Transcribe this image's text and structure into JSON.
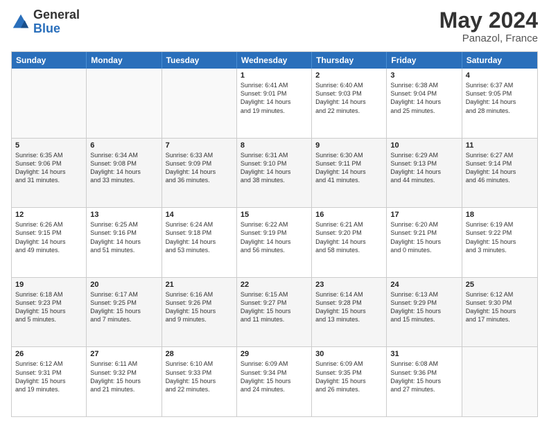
{
  "logo": {
    "general": "General",
    "blue": "Blue"
  },
  "header": {
    "month": "May 2024",
    "location": "Panazol, France"
  },
  "weekdays": [
    "Sunday",
    "Monday",
    "Tuesday",
    "Wednesday",
    "Thursday",
    "Friday",
    "Saturday"
  ],
  "rows": [
    [
      {
        "day": "",
        "info": "",
        "empty": true
      },
      {
        "day": "",
        "info": "",
        "empty": true
      },
      {
        "day": "",
        "info": "",
        "empty": true
      },
      {
        "day": "1",
        "info": "Sunrise: 6:41 AM\nSunset: 9:01 PM\nDaylight: 14 hours\nand 19 minutes."
      },
      {
        "day": "2",
        "info": "Sunrise: 6:40 AM\nSunset: 9:03 PM\nDaylight: 14 hours\nand 22 minutes."
      },
      {
        "day": "3",
        "info": "Sunrise: 6:38 AM\nSunset: 9:04 PM\nDaylight: 14 hours\nand 25 minutes."
      },
      {
        "day": "4",
        "info": "Sunrise: 6:37 AM\nSunset: 9:05 PM\nDaylight: 14 hours\nand 28 minutes."
      }
    ],
    [
      {
        "day": "5",
        "info": "Sunrise: 6:35 AM\nSunset: 9:06 PM\nDaylight: 14 hours\nand 31 minutes."
      },
      {
        "day": "6",
        "info": "Sunrise: 6:34 AM\nSunset: 9:08 PM\nDaylight: 14 hours\nand 33 minutes."
      },
      {
        "day": "7",
        "info": "Sunrise: 6:33 AM\nSunset: 9:09 PM\nDaylight: 14 hours\nand 36 minutes."
      },
      {
        "day": "8",
        "info": "Sunrise: 6:31 AM\nSunset: 9:10 PM\nDaylight: 14 hours\nand 38 minutes."
      },
      {
        "day": "9",
        "info": "Sunrise: 6:30 AM\nSunset: 9:11 PM\nDaylight: 14 hours\nand 41 minutes."
      },
      {
        "day": "10",
        "info": "Sunrise: 6:29 AM\nSunset: 9:13 PM\nDaylight: 14 hours\nand 44 minutes."
      },
      {
        "day": "11",
        "info": "Sunrise: 6:27 AM\nSunset: 9:14 PM\nDaylight: 14 hours\nand 46 minutes."
      }
    ],
    [
      {
        "day": "12",
        "info": "Sunrise: 6:26 AM\nSunset: 9:15 PM\nDaylight: 14 hours\nand 49 minutes."
      },
      {
        "day": "13",
        "info": "Sunrise: 6:25 AM\nSunset: 9:16 PM\nDaylight: 14 hours\nand 51 minutes."
      },
      {
        "day": "14",
        "info": "Sunrise: 6:24 AM\nSunset: 9:18 PM\nDaylight: 14 hours\nand 53 minutes."
      },
      {
        "day": "15",
        "info": "Sunrise: 6:22 AM\nSunset: 9:19 PM\nDaylight: 14 hours\nand 56 minutes."
      },
      {
        "day": "16",
        "info": "Sunrise: 6:21 AM\nSunset: 9:20 PM\nDaylight: 14 hours\nand 58 minutes."
      },
      {
        "day": "17",
        "info": "Sunrise: 6:20 AM\nSunset: 9:21 PM\nDaylight: 15 hours\nand 0 minutes."
      },
      {
        "day": "18",
        "info": "Sunrise: 6:19 AM\nSunset: 9:22 PM\nDaylight: 15 hours\nand 3 minutes."
      }
    ],
    [
      {
        "day": "19",
        "info": "Sunrise: 6:18 AM\nSunset: 9:23 PM\nDaylight: 15 hours\nand 5 minutes."
      },
      {
        "day": "20",
        "info": "Sunrise: 6:17 AM\nSunset: 9:25 PM\nDaylight: 15 hours\nand 7 minutes."
      },
      {
        "day": "21",
        "info": "Sunrise: 6:16 AM\nSunset: 9:26 PM\nDaylight: 15 hours\nand 9 minutes."
      },
      {
        "day": "22",
        "info": "Sunrise: 6:15 AM\nSunset: 9:27 PM\nDaylight: 15 hours\nand 11 minutes."
      },
      {
        "day": "23",
        "info": "Sunrise: 6:14 AM\nSunset: 9:28 PM\nDaylight: 15 hours\nand 13 minutes."
      },
      {
        "day": "24",
        "info": "Sunrise: 6:13 AM\nSunset: 9:29 PM\nDaylight: 15 hours\nand 15 minutes."
      },
      {
        "day": "25",
        "info": "Sunrise: 6:12 AM\nSunset: 9:30 PM\nDaylight: 15 hours\nand 17 minutes."
      }
    ],
    [
      {
        "day": "26",
        "info": "Sunrise: 6:12 AM\nSunset: 9:31 PM\nDaylight: 15 hours\nand 19 minutes."
      },
      {
        "day": "27",
        "info": "Sunrise: 6:11 AM\nSunset: 9:32 PM\nDaylight: 15 hours\nand 21 minutes."
      },
      {
        "day": "28",
        "info": "Sunrise: 6:10 AM\nSunset: 9:33 PM\nDaylight: 15 hours\nand 22 minutes."
      },
      {
        "day": "29",
        "info": "Sunrise: 6:09 AM\nSunset: 9:34 PM\nDaylight: 15 hours\nand 24 minutes."
      },
      {
        "day": "30",
        "info": "Sunrise: 6:09 AM\nSunset: 9:35 PM\nDaylight: 15 hours\nand 26 minutes."
      },
      {
        "day": "31",
        "info": "Sunrise: 6:08 AM\nSunset: 9:36 PM\nDaylight: 15 hours\nand 27 minutes."
      },
      {
        "day": "",
        "info": "",
        "empty": true
      }
    ]
  ]
}
